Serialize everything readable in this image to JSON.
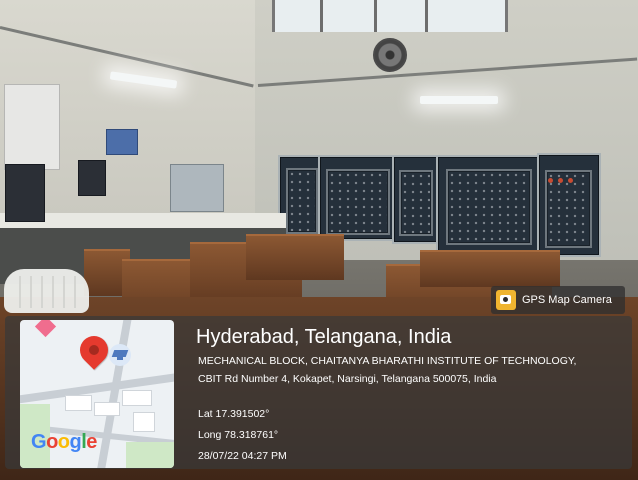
{
  "photo_scene": {
    "accent_colors": {
      "panel": "#25303b",
      "wood": "#8c5833",
      "overlay": "#393939",
      "map_pin": "#e53a2e"
    }
  },
  "camera_badge": {
    "label": "GPS Map Camera",
    "icon": "camera-icon"
  },
  "location": {
    "title": "Hyderabad, Telangana, India",
    "address": "MECHANICAL BLOCK, CHAITANYA BHARATHI INSTITUTE OF TECHNOLOGY, CBIT Rd Number 4, Kokapet, Narsingi, Telangana 500075, India",
    "lat": "Lat 17.391502°",
    "long": "Long 78.318761°",
    "timestamp": "28/07/22 04:27 PM"
  },
  "map": {
    "logo": [
      "G",
      "o",
      "o",
      "g",
      "l",
      "e"
    ],
    "pin_icon": "map-pin-icon",
    "poi_icon": "graduation-cap-icon"
  }
}
